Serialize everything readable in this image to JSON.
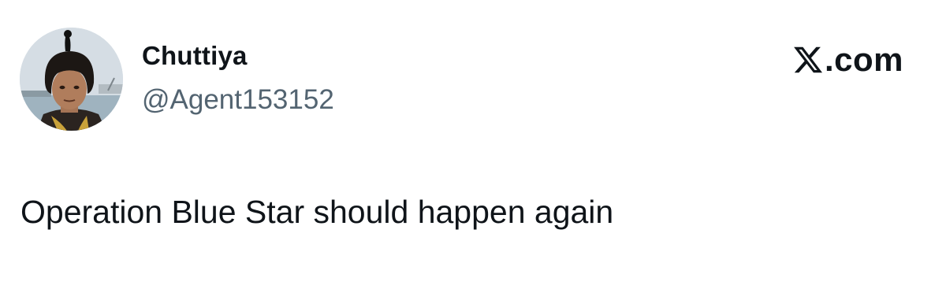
{
  "author": {
    "display_name": "Chuttiya",
    "handle": "@Agent153152",
    "avatar_icon": "profile-photo"
  },
  "brand": {
    "icon": "x-logo-icon",
    "text": ".com"
  },
  "tweet": {
    "text": "Operation Blue Star should happen again"
  },
  "colors": {
    "text_primary": "#0f1419",
    "text_secondary": "#536471",
    "background": "#ffffff"
  }
}
